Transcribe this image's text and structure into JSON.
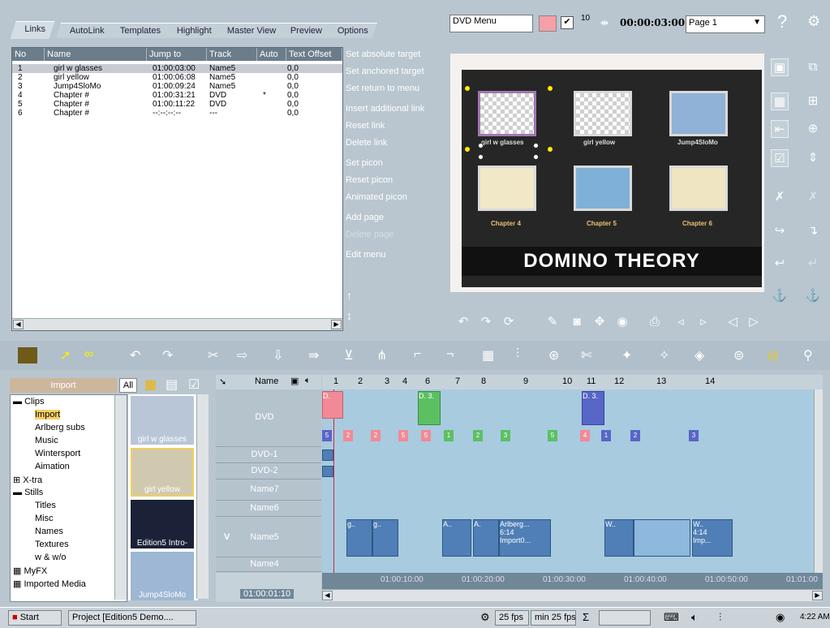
{
  "tabs": [
    {
      "label": "Links"
    },
    {
      "label": "AutoLink"
    },
    {
      "label": "Templates"
    },
    {
      "label": "Highlight"
    },
    {
      "label": "Master View"
    },
    {
      "label": "Preview"
    },
    {
      "label": "Options"
    }
  ],
  "links_table": {
    "headers": [
      "No",
      "Name",
      "Jump to",
      "Track",
      "Auto",
      "Text Offset"
    ],
    "rows": [
      {
        "no": "1",
        "name": "girl w glasses",
        "jump": "01:00:03:00",
        "track": "Name5",
        "auto": "",
        "offset": "0,0"
      },
      {
        "no": "2",
        "name": "girl yellow",
        "jump": "01:00:06:08",
        "track": "Name5",
        "auto": "",
        "offset": "0,0"
      },
      {
        "no": "3",
        "name": "Jump4SloMo",
        "jump": "01:00:09:24",
        "track": "Name5",
        "auto": "",
        "offset": "0,0"
      },
      {
        "no": "4",
        "name": "Chapter #",
        "jump": "01:00:31:21",
        "track": "DVD",
        "auto": "*",
        "offset": "0,0"
      },
      {
        "no": "5",
        "name": "Chapter #",
        "jump": "01:00:11:22",
        "track": "DVD",
        "auto": "",
        "offset": "0,0"
      },
      {
        "no": "6",
        "name": "Chapter #",
        "jump": "--:--:--:--",
        "track": "---",
        "auto": "",
        "offset": "0,0"
      }
    ]
  },
  "link_menu": [
    {
      "label": "Set absolute target"
    },
    {
      "label": "Set anchored target"
    },
    {
      "label": "Set return to menu"
    },
    {
      "label": "Insert additional link"
    },
    {
      "label": "Reset link"
    },
    {
      "label": "Delete link"
    },
    {
      "label": "Set picon"
    },
    {
      "label": "Reset picon"
    },
    {
      "label": "Animated picon"
    },
    {
      "label": "Add page"
    },
    {
      "label": "Delete page"
    },
    {
      "label": "Edit menu"
    }
  ],
  "top_toolbar": {
    "menu_name": "DVD Menu",
    "checkbox": "✔",
    "count": "10",
    "timecode": "00:00:03:00",
    "page": "Page 1"
  },
  "preview": {
    "title": "DOMINO THEORY",
    "thumbs": [
      {
        "label": "girl w glasses"
      },
      {
        "label": "girl yellow"
      },
      {
        "label": "Jump4SloMo"
      },
      {
        "label": "Chapter 4"
      },
      {
        "label": "Chapter 5"
      },
      {
        "label": "Chapter 6"
      }
    ]
  },
  "media": {
    "header": "Import",
    "all_label": "All",
    "tree": [
      {
        "label": "Clips"
      },
      {
        "label": "Import"
      },
      {
        "label": "Arlberg subs"
      },
      {
        "label": "Music"
      },
      {
        "label": "Wintersport"
      },
      {
        "label": "Aimation"
      },
      {
        "label": "X-tra"
      },
      {
        "label": "Stills"
      },
      {
        "label": "Titles"
      },
      {
        "label": "Misc"
      },
      {
        "label": "Names"
      },
      {
        "label": "Textures"
      },
      {
        "label": "w & w/o"
      },
      {
        "label": "MyFX"
      },
      {
        "label": "Imported Media"
      }
    ],
    "clips": [
      {
        "label": "girl w glasses"
      },
      {
        "label": "girl yellow"
      },
      {
        "label": "Edition5 Intro-"
      },
      {
        "label": "Jump4SloMo"
      }
    ]
  },
  "timeline": {
    "name_header": "Name",
    "tracks": [
      {
        "name": "DVD"
      },
      {
        "name": "DVD-1"
      },
      {
        "name": "DVD-2"
      },
      {
        "name": "Name7"
      },
      {
        "name": "Name6"
      },
      {
        "name": "Name5"
      },
      {
        "name": "Name4"
      }
    ],
    "track_v_label": "V",
    "ruler_marks": [
      "1",
      "2",
      "3",
      "4",
      "6",
      "7",
      "8",
      "9",
      "10",
      "11",
      "12",
      "13",
      "14"
    ],
    "times": [
      "01:00:10:00",
      "01:00:20:00",
      "01:00:30:00",
      "01:00:40:00",
      "01:00:50:00",
      "01:01:00"
    ],
    "current_time": "01:00:01:10",
    "dvd_clips": [
      {
        "label": "D."
      },
      {
        "label": "D. 3."
      },
      {
        "label": "D. 3."
      }
    ],
    "name5_clips": [
      {
        "label": "g.."
      },
      {
        "label": "g.."
      },
      {
        "label": "A.."
      },
      {
        "label": "A."
      },
      {
        "label": "Arlberg..."
      },
      {
        "label": "6:14"
      },
      {
        "label": "Import0..."
      },
      {
        "label": "W.."
      },
      {
        "label": "W.."
      },
      {
        "label": "4:14"
      },
      {
        "label": "Imp..."
      }
    ],
    "flags": [
      "5",
      "2",
      "2",
      "5",
      "5",
      "1",
      "2",
      "3",
      "5",
      "4",
      "1",
      "2",
      "3"
    ]
  },
  "statusbar": {
    "start": "Start",
    "task": "Project [Edition5 Demo....",
    "fps": "25 fps",
    "minfps": "min 25 fps",
    "sigma": "Σ",
    "clock": "4:22 AM"
  },
  "colors": {
    "panel": "#b9c6cf",
    "table_header": "#6b7d8b",
    "import_header": "#ccb69c",
    "timeline_bg": "#a8cbe0",
    "clip_blue": "#4f7fb6",
    "flag_pink": "#f28a96",
    "flag_green": "#5cc063",
    "flag_blue": "#5866c7"
  }
}
